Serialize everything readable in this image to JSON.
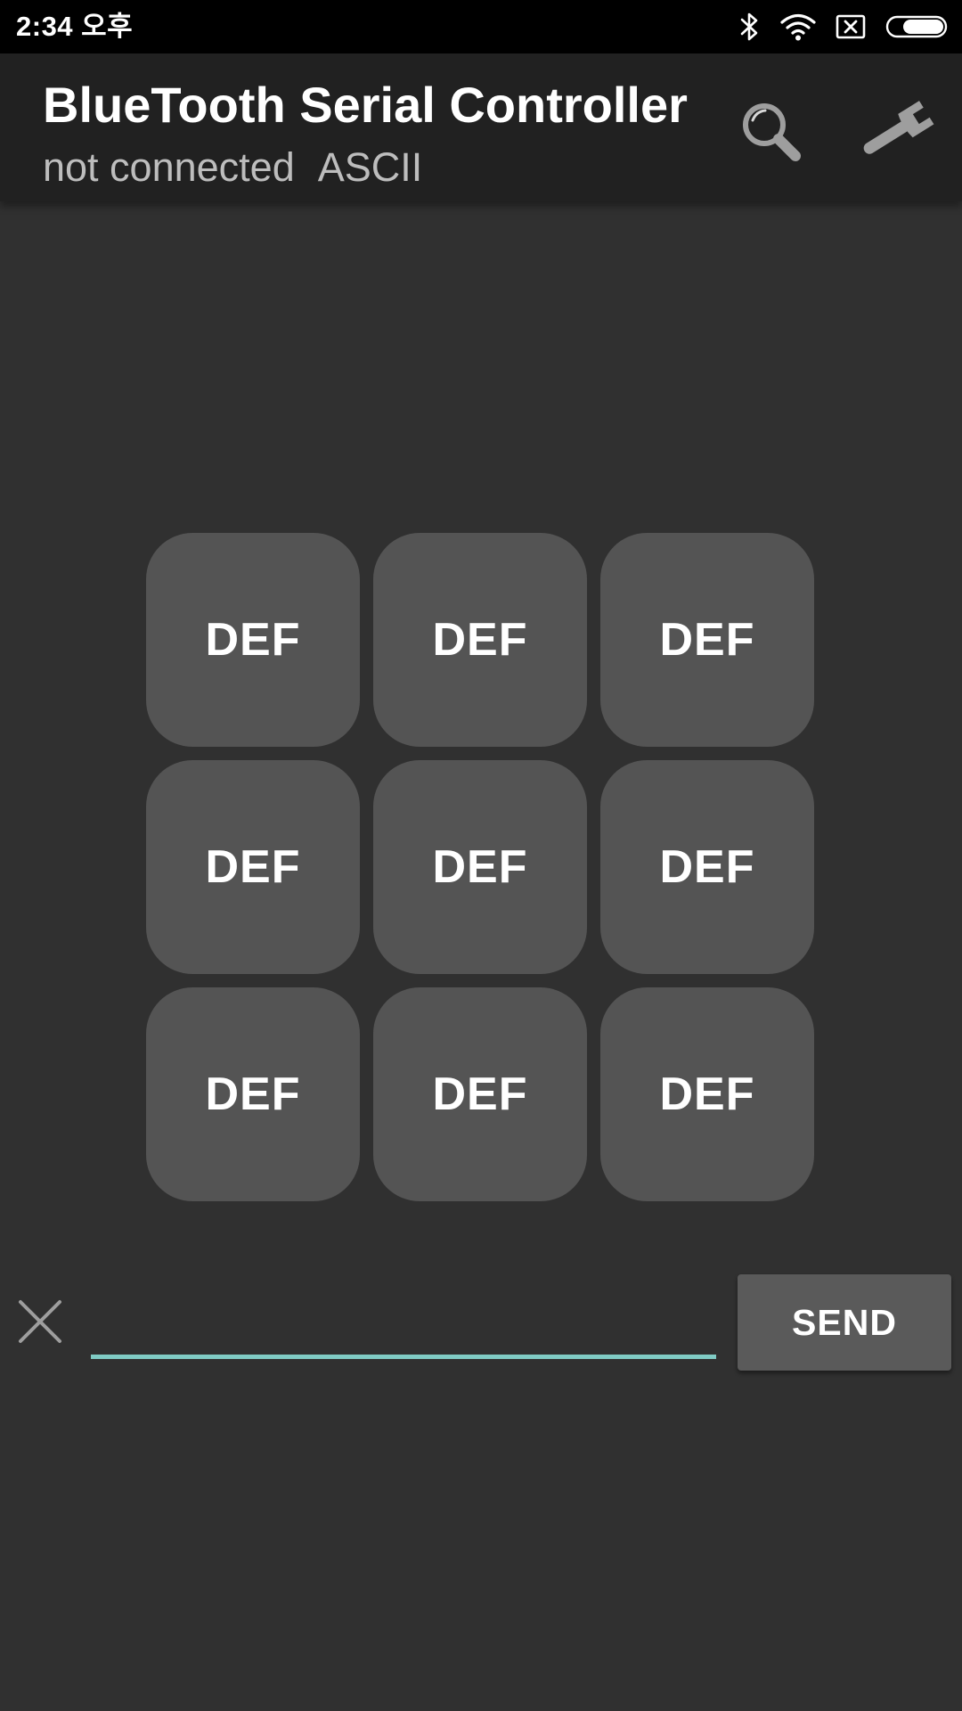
{
  "status_bar": {
    "time": "2:34 오후",
    "icons": [
      "bluetooth-icon",
      "wifi-icon",
      "sim-missing-icon",
      "battery-icon"
    ],
    "battery_level": 0.75
  },
  "app_bar": {
    "title": "BlueTooth Serial Controller",
    "connection_status": "not connected",
    "mode": "ASCII",
    "actions": [
      "search-icon",
      "wrench-icon"
    ]
  },
  "buttons": [
    {
      "label": "DEF"
    },
    {
      "label": "DEF"
    },
    {
      "label": "DEF"
    },
    {
      "label": "DEF"
    },
    {
      "label": "DEF"
    },
    {
      "label": "DEF"
    },
    {
      "label": "DEF"
    },
    {
      "label": "DEF"
    },
    {
      "label": "DEF"
    }
  ],
  "input": {
    "value": "",
    "placeholder": ""
  },
  "send_button": {
    "label": "SEND"
  },
  "colors": {
    "background": "#303030",
    "app_bar": "#212121",
    "button": "#545454",
    "accent_underline": "#80cbc4"
  }
}
